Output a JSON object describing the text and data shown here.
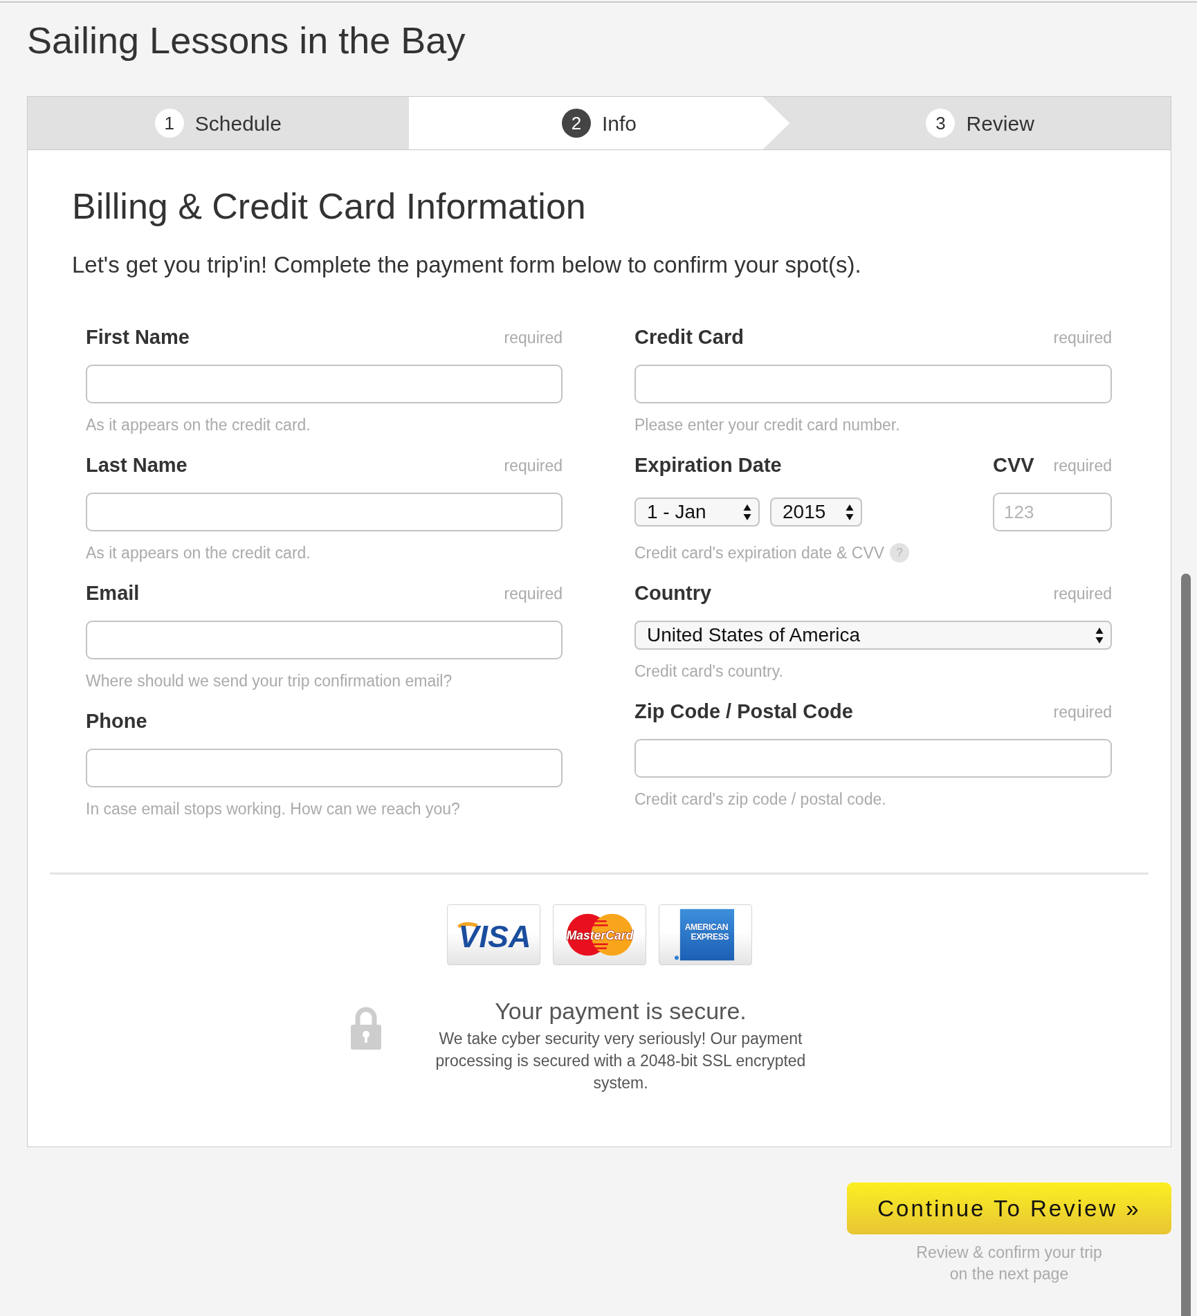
{
  "page_title": "Sailing Lessons in the Bay",
  "steps": [
    {
      "number": "1",
      "label": "Schedule",
      "selected": false
    },
    {
      "number": "2",
      "label": "Info",
      "selected": true
    },
    {
      "number": "3",
      "label": "Review",
      "selected": false
    }
  ],
  "form": {
    "title": "Billing & Credit Card Information",
    "intro": "Let's get you trip'in! Complete the payment form below to confirm your spot(s).",
    "columns": [
      [
        {
          "kind": "text",
          "label": "First Name",
          "required_note": "required",
          "help": "As it appears on the credit card."
        },
        {
          "kind": "text",
          "label": "Last Name",
          "required_note": "required",
          "help": "As it appears on the credit card."
        },
        {
          "kind": "text",
          "label": "Email",
          "required_note": "required",
          "help": "Where should we send your trip confirmation email?"
        },
        {
          "kind": "text",
          "label": "Phone",
          "help": "In case email stops working. How can we reach you?"
        }
      ],
      [
        {
          "kind": "text",
          "label": "Credit Card",
          "required_note": "required",
          "help": "Please enter your credit card number."
        },
        {
          "kind": "expiry",
          "label": "Expiration Date",
          "month": "1 - Jan",
          "year": "2015",
          "cvv": {
            "label": "CVV",
            "required_note": "required",
            "placeholder": "123"
          },
          "help": "Credit card's expiration date & CVV",
          "help_badge": "?"
        },
        {
          "kind": "select",
          "label": "Country",
          "required_note": "required",
          "value": "United States of America",
          "help": "Credit card's country."
        },
        {
          "kind": "text",
          "label": "Zip Code / Postal Code",
          "required_note": "required",
          "help": "Credit card's zip code / postal code."
        }
      ]
    ]
  },
  "payment": {
    "card_logos": [
      {
        "kind": "visa",
        "lines": [
          "VISA"
        ]
      },
      {
        "kind": "mastercard",
        "lines": [
          "MasterCard"
        ]
      },
      {
        "kind": "amex",
        "lines": [
          "AMERICAN",
          "EXPRESS"
        ]
      }
    ],
    "security": {
      "title": "Your payment is secure.",
      "text": "We take cyber security very seriously! Our payment processing is secured with a 2048-bit SSL encrypted system."
    }
  },
  "footer": {
    "button": "Continue To Review »",
    "caption": "Review & confirm your trip on the next page"
  }
}
